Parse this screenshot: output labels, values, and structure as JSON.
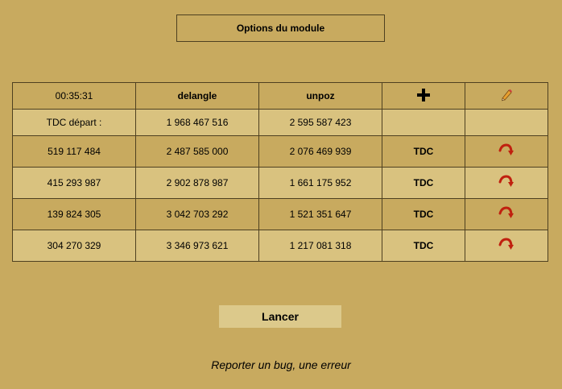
{
  "header": {
    "options_label": "Options du module"
  },
  "table": {
    "columns": {
      "time": "00:35:31",
      "col1": "delangle",
      "col2": "unpoz"
    },
    "start_row": {
      "label": "TDC départ :",
      "col1": "1 968 467 516",
      "col2": "2 595 587 423"
    },
    "rows": [
      {
        "col0": "519 117 484",
        "col1": "2 487 585 000",
        "col2": "2 076 469 939",
        "action": "TDC"
      },
      {
        "col0": "415 293 987",
        "col1": "2 902 878 987",
        "col2": "1 661 175 952",
        "action": "TDC"
      },
      {
        "col0": "139 824 305",
        "col1": "3 042 703 292",
        "col2": "1 521 351 647",
        "action": "TDC"
      },
      {
        "col0": "304 270 329",
        "col1": "3 346 973 621",
        "col2": "1 217 081 318",
        "action": "TDC"
      }
    ],
    "icons": {
      "add": "plus-icon",
      "edit": "pencil-icon",
      "row_action": "curved-arrow-icon"
    }
  },
  "footer": {
    "launch_label": "Lancer",
    "bug_label": "Reporter un bug, une erreur"
  },
  "colors": {
    "background": "#c8aa5f",
    "row_light": "#d9c27f",
    "border": "#4e4020",
    "button_bg": "#dcc98b",
    "arrow_red": "#c0200f"
  }
}
